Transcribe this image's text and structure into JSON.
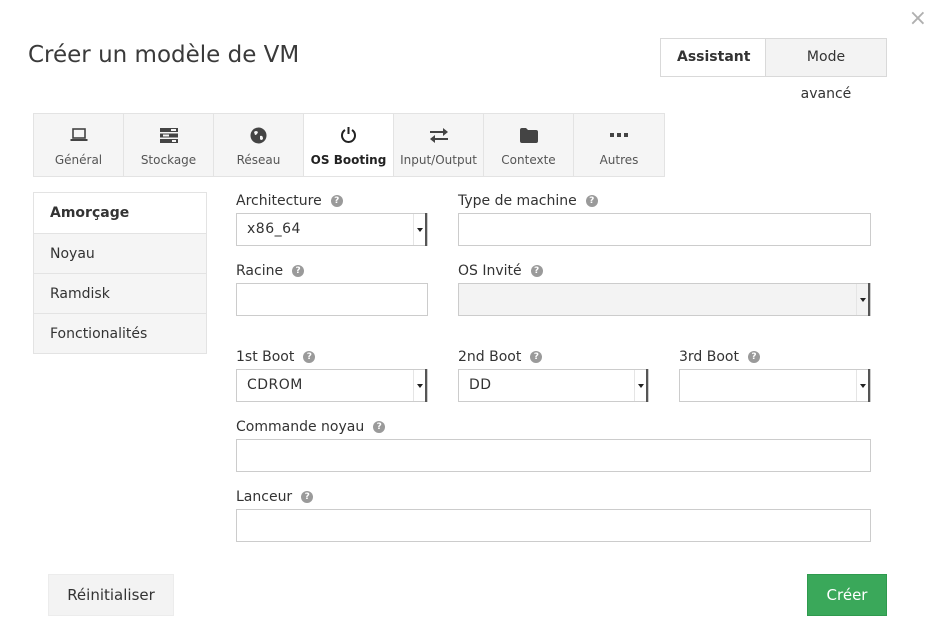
{
  "dialog": {
    "title": "Créer un modèle de VM",
    "close_glyph": "×"
  },
  "mode": {
    "wizard_label": "Assistant",
    "advanced_label": "Mode avancé"
  },
  "tabs": [
    {
      "label": "Général",
      "icon": "laptop-icon"
    },
    {
      "label": "Stockage",
      "icon": "tasks-icon"
    },
    {
      "label": "Réseau",
      "icon": "globe-icon"
    },
    {
      "label": "OS Booting",
      "icon": "power-icon"
    },
    {
      "label": "Input/Output",
      "icon": "exchange-icon"
    },
    {
      "label": "Contexte",
      "icon": "folder-icon"
    },
    {
      "label": "Autres",
      "icon": "ellipsis-icon"
    }
  ],
  "sidebar": {
    "items": [
      {
        "label": "Amorçage"
      },
      {
        "label": "Noyau"
      },
      {
        "label": "Ramdisk"
      },
      {
        "label": "Fonctionalités"
      }
    ]
  },
  "form": {
    "architecture": {
      "label": "Architecture",
      "value": "x86_64"
    },
    "machine_type": {
      "label": "Type de machine",
      "value": ""
    },
    "root": {
      "label": "Racine",
      "value": ""
    },
    "guest_os": {
      "label": "OS Invité",
      "value": ""
    },
    "boot1": {
      "label": "1st Boot",
      "value": "CDROM"
    },
    "boot2": {
      "label": "2nd Boot",
      "value": "DD"
    },
    "boot3": {
      "label": "3rd Boot",
      "value": ""
    },
    "kernel_cmd": {
      "label": "Commande noyau",
      "value": ""
    },
    "bootloader": {
      "label": "Lanceur",
      "value": ""
    },
    "help_glyph": "?"
  },
  "footer": {
    "reset_label": "Réinitialiser",
    "create_label": "Créer"
  },
  "colors": {
    "create_button": "#3aa85a",
    "tab_bg": "#f5f5f5"
  }
}
